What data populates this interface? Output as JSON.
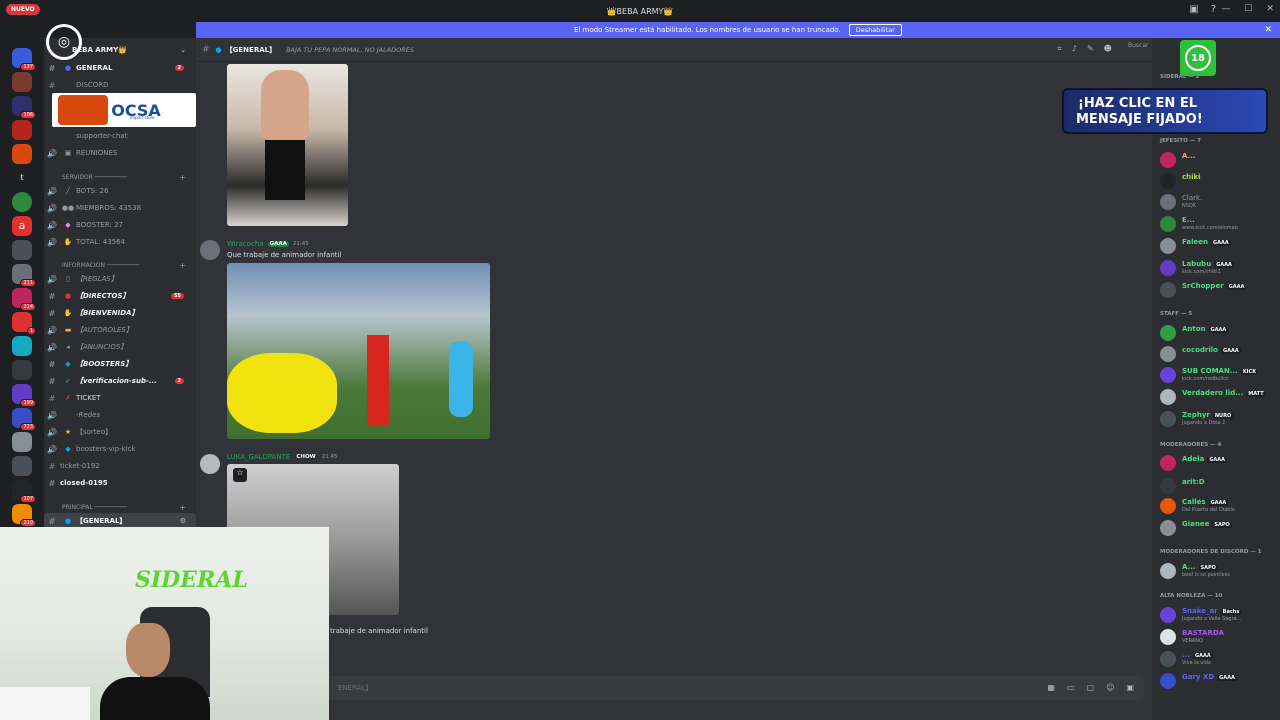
{
  "window": {
    "title": "👑BEBA ARMY👑",
    "nuevo_badge": "NUEVO"
  },
  "streamer_bar": {
    "message": "El modo Streamer está habilitado. Los nombres de usuario se han truncado.",
    "button": "Deshabilitar"
  },
  "guild_badges": [
    "137",
    "106",
    "211",
    "214",
    "1",
    "199",
    "723",
    "107",
    "210"
  ],
  "server": {
    "name": "BEBA ARMY👑",
    "channels_top": [
      {
        "label": "GENERAL",
        "count": "2"
      },
      {
        "label": "DISCORD"
      },
      {
        "label": "supporter-chat"
      },
      {
        "label": "REUNIONES"
      }
    ],
    "category_servidor": "SERVIDOR ─────────",
    "stats": [
      {
        "label": "BOTS: 26"
      },
      {
        "label": "MIEMBROS: 43538"
      },
      {
        "label": "BOOSTER: 27"
      },
      {
        "label": "TOTAL: 43564"
      }
    ],
    "category_informacion": "INFORMACION ─────────",
    "info_channels": [
      {
        "label": "【REGLAS】"
      },
      {
        "label": "【DIRECTOS】",
        "count": "55"
      },
      {
        "label": "【BIENVENIDA】"
      },
      {
        "label": "【AUTOROLES】"
      },
      {
        "label": "【ANUNCIOS】"
      },
      {
        "label": "【BOOSTERS】"
      },
      {
        "label": "【verificacion-sub-...",
        "count": "2"
      },
      {
        "label": "TICKET"
      },
      {
        "label": "-Redes"
      },
      {
        "label": "【sorteo】"
      },
      {
        "label": "boosters-vip-kick"
      },
      {
        "label": "ticket-0192"
      },
      {
        "label": "closed-0195"
      }
    ],
    "category_principal": "PRINCIPAL ─────────",
    "selected_channel": "【GENERAL】"
  },
  "chat": {
    "channel_name": "【GENERAL】",
    "topic": "BAJA TU PEPA NORMAL, NO JALADORES",
    "search_placeholder": "Buscar",
    "messages": [
      {
        "author": "Wiracocha",
        "tag": "GAAA",
        "time": "21:45",
        "text": "Que trabaje de animador infantil"
      },
      {
        "author": "LUKA_GALOPANTE",
        "tag": "CHOW",
        "time": "21:45",
        "text": "trabaje de animador infantil"
      }
    ],
    "composer_placeholder": "ENERAL】"
  },
  "overlays": {
    "sponsor": "OCSA",
    "sponsor_sub": "import store",
    "promo_line1": "¡HAZ CLIC EN EL",
    "promo_line2": "MENSAJE FIJADO!",
    "age": "18",
    "webcam_logo": "SIDERAL"
  },
  "members": {
    "sections": [
      {
        "title": "SIDERAL — 2"
      },
      {
        "title": "JEFESITO — 7"
      },
      {
        "title": "STAFF — 5"
      },
      {
        "title": "MODERADORES — 4"
      },
      {
        "title": "MODERADORES DE DISCORD — 1"
      },
      {
        "title": "ALTA NOBLEZA — 10"
      }
    ],
    "list": [
      {
        "name": "A...",
        "color": "#f0b232"
      },
      {
        "name": "chiki",
        "color": "#a3e635"
      },
      {
        "name": "Clark.",
        "status": "NSQK",
        "color": "#949ba4"
      },
      {
        "name": "E...",
        "status": "www.kick.com/elomao",
        "color": "#4ade80"
      },
      {
        "name": "Faleen",
        "tag": "GAAA",
        "color": "#4ade80"
      },
      {
        "name": "Labubu",
        "tag": "GAAA",
        "status": "kick.com/chiki1",
        "color": "#4ade80"
      },
      {
        "name": "SrChopper",
        "tag": "GAAA",
        "color": "#4ade80"
      },
      {
        "name": "Anton",
        "tag": "GAAA",
        "color": "#4ade80"
      },
      {
        "name": "cocodrilo",
        "tag": "GAAA",
        "color": "#4ade80"
      },
      {
        "name": "SUB COMAN...",
        "tag": "KICK",
        "status": "kick.com/redbullcc",
        "color": "#4ade80"
      },
      {
        "name": "Verdadero lid...",
        "tag": "MATT",
        "color": "#4ade80"
      },
      {
        "name": "Zephyr",
        "tag": "NURO",
        "status": "Jugando a Dota 2",
        "color": "#4ade80"
      },
      {
        "name": "Adela",
        "tag": "GAAA",
        "color": "#4ade80"
      },
      {
        "name": "arit:D",
        "color": "#4ade80"
      },
      {
        "name": "Calles",
        "tag": "GAAA",
        "status": "Del Puerto del Diablo",
        "color": "#4ade80"
      },
      {
        "name": "Gianee",
        "tag": "SAPO",
        "color": "#4ade80"
      },
      {
        "name": "A...",
        "tag": "SAPO",
        "status": "beef is so pointless",
        "color": "#4ade80"
      },
      {
        "name": "Snake_ar",
        "tag": "Bachs",
        "status": "Jugando a Valle Sagra...",
        "color": "#5865f2"
      },
      {
        "name": "BASTARDA",
        "status": "VERANO",
        "color": "#a855f7"
      },
      {
        "name": "...",
        "tag": "GAAA",
        "status": "Viva la vida",
        "color": "#5865f2"
      },
      {
        "name": "Gary XD",
        "tag": "GAAA",
        "color": "#5865f2"
      }
    ]
  }
}
